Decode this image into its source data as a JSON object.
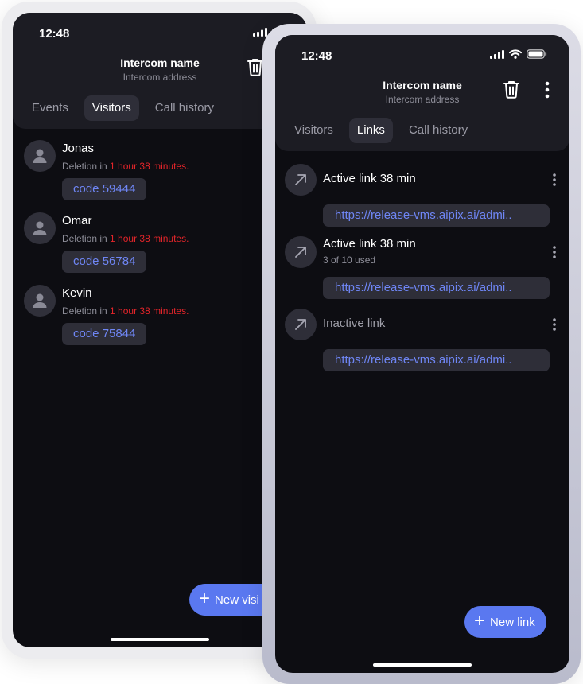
{
  "back_phone": {
    "status_time": "12:48",
    "title": "Intercom name",
    "subtitle": "Intercom address",
    "tabs": [
      {
        "label": "Events",
        "active": false
      },
      {
        "label": "Visitors",
        "active": true
      },
      {
        "label": "Call history",
        "active": false
      }
    ],
    "visitors": [
      {
        "name": "Jonas",
        "deletion_prefix": "Deletion in ",
        "deletion_time": "1 hour 38 minutes.",
        "code": "code 59444"
      },
      {
        "name": "Omar",
        "deletion_prefix": "Deletion in ",
        "deletion_time": "1 hour 38 minutes.",
        "code": "code 56784"
      },
      {
        "name": "Kevin",
        "deletion_prefix": "Deletion in ",
        "deletion_time": "1 hour 38 minutes.",
        "code": "code 75844"
      }
    ],
    "fab_label": "New visi"
  },
  "front_phone": {
    "status_time": "12:48",
    "title": "Intercom name",
    "subtitle": "Intercom address",
    "tabs": [
      {
        "label": "Visitors",
        "active": false
      },
      {
        "label": "Links",
        "active": true
      },
      {
        "label": "Call history",
        "active": false
      }
    ],
    "links": [
      {
        "title": "Active link 38 min",
        "sub": "",
        "url": "https://release-vms.aipix.ai/admi..",
        "active": true
      },
      {
        "title": "Active link 38 min",
        "sub": "3 of 10 used",
        "url": "https://release-vms.aipix.ai/admi..",
        "active": true
      },
      {
        "title": "Inactive link",
        "sub": "",
        "url": "https://release-vms.aipix.ai/admi..",
        "active": false
      }
    ],
    "fab_label": "New link"
  },
  "colors": {
    "background": "#0d0d12",
    "header": "#1c1c23",
    "chip": "#2e2e38",
    "accent": "#5a78f0",
    "link_text": "#6f86f5",
    "warning": "#e5252a"
  },
  "icons": [
    "signal-icon",
    "wifi-icon",
    "battery-icon",
    "trash-icon",
    "more-vertical-icon",
    "user-icon",
    "arrow-up-right-icon",
    "plus-icon"
  ]
}
